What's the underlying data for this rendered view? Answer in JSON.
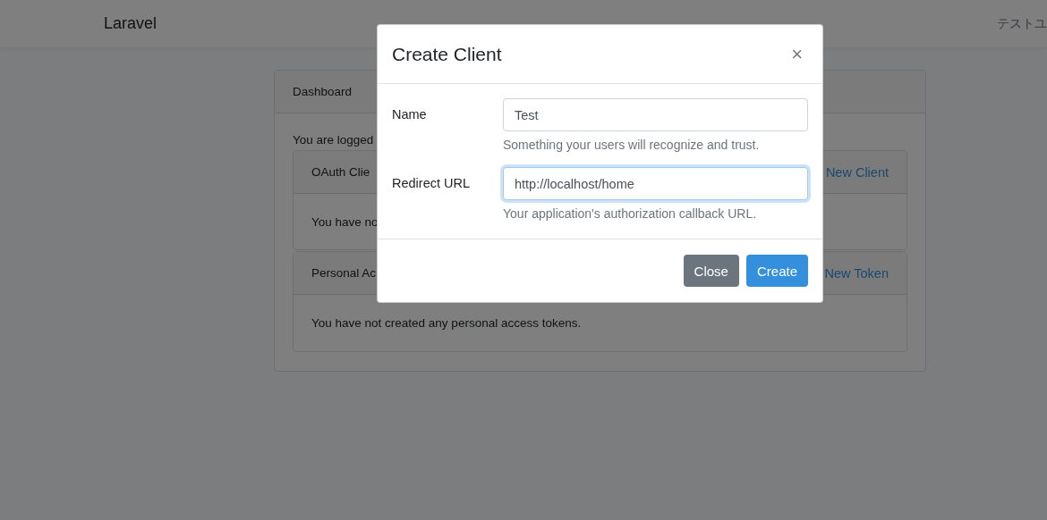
{
  "navbar": {
    "brand": "Laravel",
    "user": "テストユ"
  },
  "dashboard": {
    "title": "Dashboard",
    "intro": "You are logged",
    "sections": [
      {
        "title": "OAuth Clie",
        "action": "New Client",
        "message": "You have no"
      },
      {
        "title": "Personal Ac",
        "action": "New Token",
        "message": "You have not created any personal access tokens."
      }
    ]
  },
  "modal": {
    "title": "Create Client",
    "close": "×",
    "fields": [
      {
        "label": "Name",
        "value": "Test",
        "help": "Something your users will recognize and trust.",
        "focused": false
      },
      {
        "label": "Redirect URL",
        "value": "http://localhost/home",
        "help": "Your application's authorization callback URL.",
        "focused": true
      }
    ],
    "buttons": [
      {
        "label": "Close",
        "kind": "secondary"
      },
      {
        "label": "Create",
        "kind": "primary"
      }
    ]
  }
}
